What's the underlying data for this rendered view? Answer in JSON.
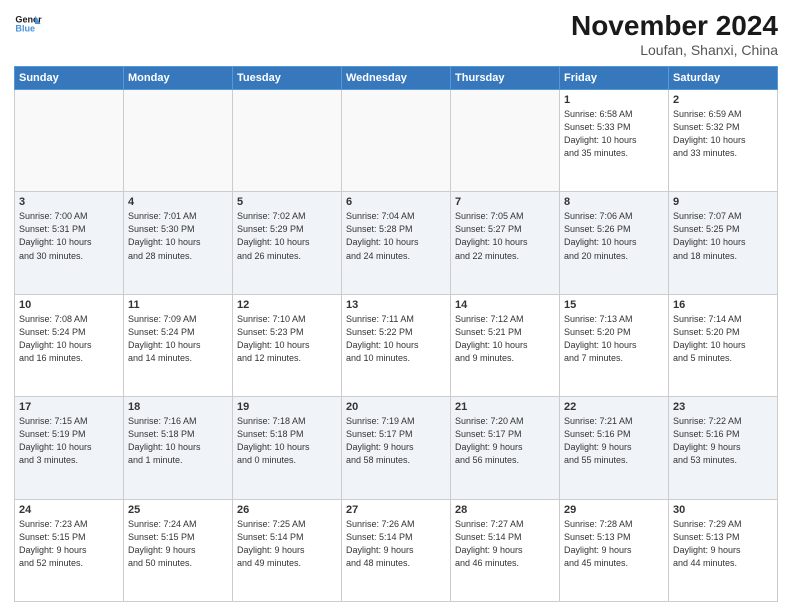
{
  "logo": {
    "line1": "General",
    "line2": "Blue"
  },
  "title": "November 2024",
  "location": "Loufan, Shanxi, China",
  "days_header": [
    "Sunday",
    "Monday",
    "Tuesday",
    "Wednesday",
    "Thursday",
    "Friday",
    "Saturday"
  ],
  "weeks": [
    [
      {
        "day": "",
        "info": ""
      },
      {
        "day": "",
        "info": ""
      },
      {
        "day": "",
        "info": ""
      },
      {
        "day": "",
        "info": ""
      },
      {
        "day": "",
        "info": ""
      },
      {
        "day": "1",
        "info": "Sunrise: 6:58 AM\nSunset: 5:33 PM\nDaylight: 10 hours\nand 35 minutes."
      },
      {
        "day": "2",
        "info": "Sunrise: 6:59 AM\nSunset: 5:32 PM\nDaylight: 10 hours\nand 33 minutes."
      }
    ],
    [
      {
        "day": "3",
        "info": "Sunrise: 7:00 AM\nSunset: 5:31 PM\nDaylight: 10 hours\nand 30 minutes."
      },
      {
        "day": "4",
        "info": "Sunrise: 7:01 AM\nSunset: 5:30 PM\nDaylight: 10 hours\nand 28 minutes."
      },
      {
        "day": "5",
        "info": "Sunrise: 7:02 AM\nSunset: 5:29 PM\nDaylight: 10 hours\nand 26 minutes."
      },
      {
        "day": "6",
        "info": "Sunrise: 7:04 AM\nSunset: 5:28 PM\nDaylight: 10 hours\nand 24 minutes."
      },
      {
        "day": "7",
        "info": "Sunrise: 7:05 AM\nSunset: 5:27 PM\nDaylight: 10 hours\nand 22 minutes."
      },
      {
        "day": "8",
        "info": "Sunrise: 7:06 AM\nSunset: 5:26 PM\nDaylight: 10 hours\nand 20 minutes."
      },
      {
        "day": "9",
        "info": "Sunrise: 7:07 AM\nSunset: 5:25 PM\nDaylight: 10 hours\nand 18 minutes."
      }
    ],
    [
      {
        "day": "10",
        "info": "Sunrise: 7:08 AM\nSunset: 5:24 PM\nDaylight: 10 hours\nand 16 minutes."
      },
      {
        "day": "11",
        "info": "Sunrise: 7:09 AM\nSunset: 5:24 PM\nDaylight: 10 hours\nand 14 minutes."
      },
      {
        "day": "12",
        "info": "Sunrise: 7:10 AM\nSunset: 5:23 PM\nDaylight: 10 hours\nand 12 minutes."
      },
      {
        "day": "13",
        "info": "Sunrise: 7:11 AM\nSunset: 5:22 PM\nDaylight: 10 hours\nand 10 minutes."
      },
      {
        "day": "14",
        "info": "Sunrise: 7:12 AM\nSunset: 5:21 PM\nDaylight: 10 hours\nand 9 minutes."
      },
      {
        "day": "15",
        "info": "Sunrise: 7:13 AM\nSunset: 5:20 PM\nDaylight: 10 hours\nand 7 minutes."
      },
      {
        "day": "16",
        "info": "Sunrise: 7:14 AM\nSunset: 5:20 PM\nDaylight: 10 hours\nand 5 minutes."
      }
    ],
    [
      {
        "day": "17",
        "info": "Sunrise: 7:15 AM\nSunset: 5:19 PM\nDaylight: 10 hours\nand 3 minutes."
      },
      {
        "day": "18",
        "info": "Sunrise: 7:16 AM\nSunset: 5:18 PM\nDaylight: 10 hours\nand 1 minute."
      },
      {
        "day": "19",
        "info": "Sunrise: 7:18 AM\nSunset: 5:18 PM\nDaylight: 10 hours\nand 0 minutes."
      },
      {
        "day": "20",
        "info": "Sunrise: 7:19 AM\nSunset: 5:17 PM\nDaylight: 9 hours\nand 58 minutes."
      },
      {
        "day": "21",
        "info": "Sunrise: 7:20 AM\nSunset: 5:17 PM\nDaylight: 9 hours\nand 56 minutes."
      },
      {
        "day": "22",
        "info": "Sunrise: 7:21 AM\nSunset: 5:16 PM\nDaylight: 9 hours\nand 55 minutes."
      },
      {
        "day": "23",
        "info": "Sunrise: 7:22 AM\nSunset: 5:16 PM\nDaylight: 9 hours\nand 53 minutes."
      }
    ],
    [
      {
        "day": "24",
        "info": "Sunrise: 7:23 AM\nSunset: 5:15 PM\nDaylight: 9 hours\nand 52 minutes."
      },
      {
        "day": "25",
        "info": "Sunrise: 7:24 AM\nSunset: 5:15 PM\nDaylight: 9 hours\nand 50 minutes."
      },
      {
        "day": "26",
        "info": "Sunrise: 7:25 AM\nSunset: 5:14 PM\nDaylight: 9 hours\nand 49 minutes."
      },
      {
        "day": "27",
        "info": "Sunrise: 7:26 AM\nSunset: 5:14 PM\nDaylight: 9 hours\nand 48 minutes."
      },
      {
        "day": "28",
        "info": "Sunrise: 7:27 AM\nSunset: 5:14 PM\nDaylight: 9 hours\nand 46 minutes."
      },
      {
        "day": "29",
        "info": "Sunrise: 7:28 AM\nSunset: 5:13 PM\nDaylight: 9 hours\nand 45 minutes."
      },
      {
        "day": "30",
        "info": "Sunrise: 7:29 AM\nSunset: 5:13 PM\nDaylight: 9 hours\nand 44 minutes."
      }
    ]
  ]
}
